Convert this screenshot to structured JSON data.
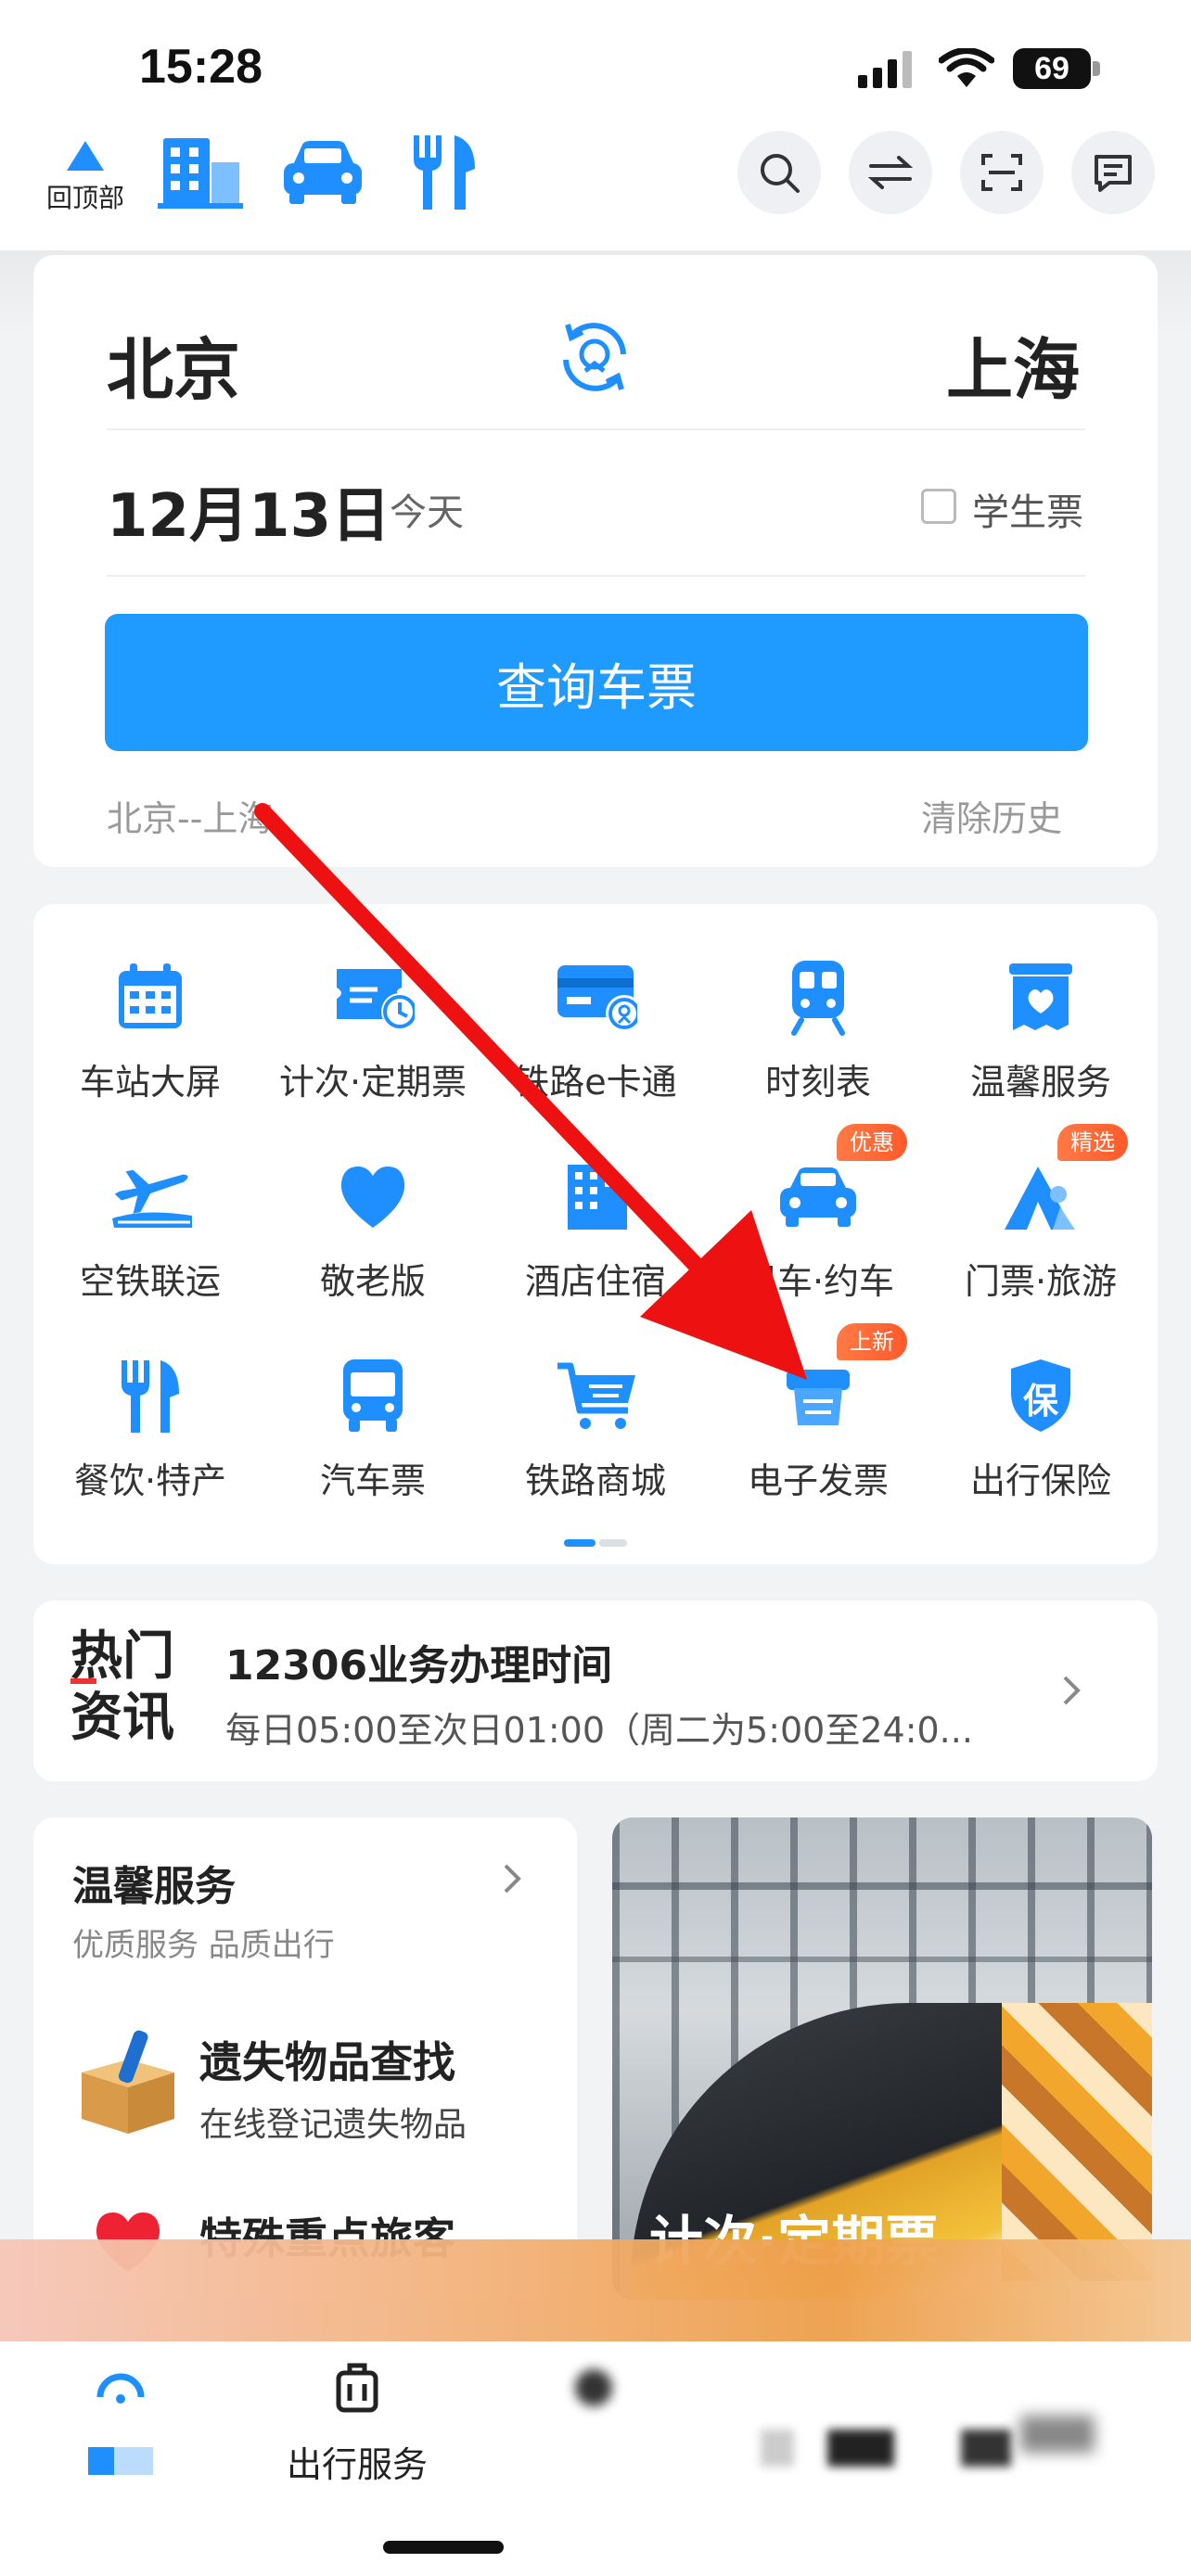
{
  "status_bar": {
    "time": "15:28",
    "battery": "69"
  },
  "top_nav": {
    "back_to_top_label": "回顶部",
    "icons": [
      "hotel-icon",
      "car-icon",
      "dining-icon",
      "search-icon",
      "switch-icon",
      "scan-icon",
      "message-icon"
    ]
  },
  "booking": {
    "from_city": "北京",
    "to_city": "上海",
    "date": "12月13日",
    "day_label": "今天",
    "student_ticket_label": "学生票",
    "query_button": "查询车票",
    "history_route": "北京--上海",
    "clear_history": "清除历史"
  },
  "services": {
    "items": [
      {
        "label": "车站大屏",
        "icon": "calendar-icon"
      },
      {
        "label": "计次·定期票",
        "icon": "ticket-clock-icon"
      },
      {
        "label": "铁路e卡通",
        "icon": "card-icon"
      },
      {
        "label": "时刻表",
        "icon": "train-icon"
      },
      {
        "label": "温馨服务",
        "icon": "heart-box-icon"
      },
      {
        "label": "空铁联运",
        "icon": "plane-train-icon"
      },
      {
        "label": "敬老版",
        "icon": "heart-icon"
      },
      {
        "label": "酒店住宿",
        "icon": "hotel-icon"
      },
      {
        "label": "租车·约车",
        "icon": "car-icon",
        "badge": "优惠"
      },
      {
        "label": "门票·旅游",
        "icon": "mountain-icon",
        "badge": "精选"
      },
      {
        "label": "餐饮·特产",
        "icon": "dining-icon"
      },
      {
        "label": "汽车票",
        "icon": "bus-icon"
      },
      {
        "label": "铁路商城",
        "icon": "cart-icon"
      },
      {
        "label": "电子发票",
        "icon": "invoice-icon",
        "badge": "上新"
      },
      {
        "label": "出行保险",
        "icon": "shield-icon",
        "shield_text": "保"
      }
    ]
  },
  "news": {
    "tag_line1": "热门",
    "tag_line2": "资讯",
    "title": "12306业务办理时间",
    "subtitle": "每日05:00至次日01:00（周二为5:00至24:0..."
  },
  "warm_service": {
    "title": "温馨服务",
    "subtitle": "优质服务 品质出行",
    "items": [
      {
        "title": "遗失物品查找",
        "desc": "在线登记遗失物品"
      },
      {
        "title": "特殊重点旅客",
        "desc": ""
      }
    ]
  },
  "promo": {
    "overlay_text": "计次·定期票"
  },
  "tab_bar": {
    "items": [
      {
        "label": "",
        "icon": "home-icon"
      },
      {
        "label": "出行服务",
        "icon": "luggage-icon"
      }
    ]
  },
  "annotation": {
    "arrow_color": "#ee1111"
  },
  "colors": {
    "accent": "#1f8fff",
    "badge": "#ff6a33"
  }
}
